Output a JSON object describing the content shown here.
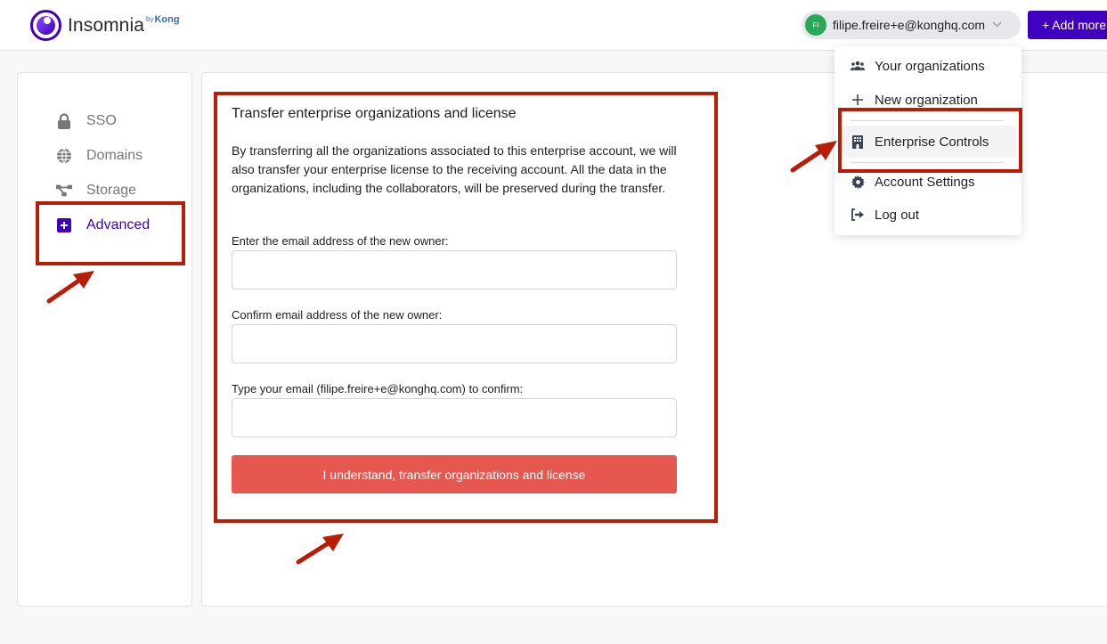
{
  "header": {
    "logo_text": "Insomnia",
    "logo_by": "by",
    "logo_brand": "Kong",
    "account": {
      "initials": "FI",
      "email": "filipe.freire+e@konghq.com",
      "chevron_icon": "chevron-down-icon"
    },
    "add_more_label": "+ Add more"
  },
  "sidebar": {
    "items": [
      {
        "label": "SSO",
        "icon": "lock-icon",
        "active": false
      },
      {
        "label": "Domains",
        "icon": "globe-icon",
        "active": false
      },
      {
        "label": "Storage",
        "icon": "share-nodes-icon",
        "active": false
      },
      {
        "label": "Advanced",
        "icon": "plus-square-icon",
        "active": true
      }
    ]
  },
  "transfer_form": {
    "title": "Transfer enterprise organizations and license",
    "description": "By transferring all the organizations associated to this enterprise account, we will also transfer your enterprise license to the receiving account. All the data in the organizations, including the collaborators, will be preserved during the transfer.",
    "fields": [
      {
        "label": "Enter the email address of the new owner:",
        "value": "",
        "placeholder": ""
      },
      {
        "label": "Confirm email address of the new owner:",
        "value": "",
        "placeholder": ""
      },
      {
        "label": "Type your email (filipe.freire+e@konghq.com) to confirm:",
        "value": "",
        "placeholder": ""
      }
    ],
    "submit_label": "I understand, transfer organizations and license"
  },
  "account_menu": {
    "items": [
      {
        "label": "Your organizations",
        "icon": "users-icon"
      },
      {
        "label": "New organization",
        "icon": "plus-icon"
      },
      {
        "label": "Enterprise Controls",
        "icon": "building-icon",
        "highlighted": true
      },
      {
        "label": "Account Settings",
        "icon": "gear-icon"
      },
      {
        "label": "Log out",
        "icon": "logout-icon"
      }
    ]
  },
  "colors": {
    "brand": "#4000bf",
    "danger": "#e5574f",
    "annotation": "#b81d05",
    "avatar": "#27a955"
  }
}
